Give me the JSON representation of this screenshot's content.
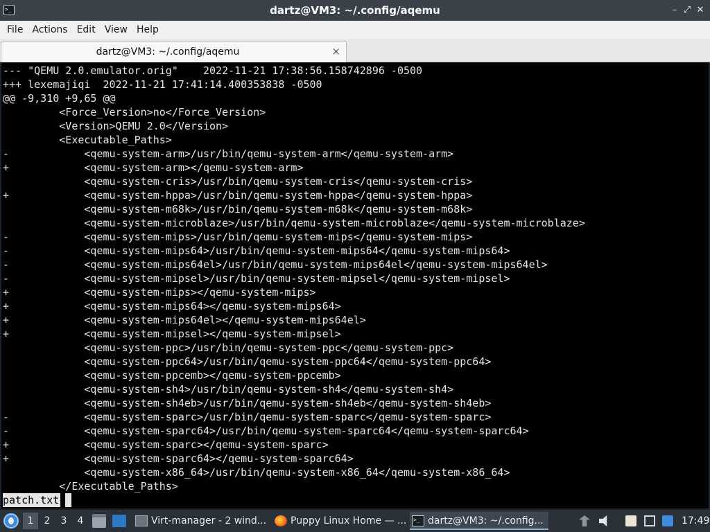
{
  "window": {
    "title": "dartz@VM3: ~/.config/aqemu",
    "app_icon_glyph": ">_",
    "controls": {
      "minimize": "–",
      "maximize": "⤢",
      "close": "✕"
    }
  },
  "menubar": {
    "items": [
      "File",
      "Actions",
      "Edit",
      "View",
      "Help"
    ]
  },
  "tabs": [
    {
      "label": "dartz@VM3: ~/.config/aqemu",
      "close": "×"
    }
  ],
  "terminal": {
    "lines": [
      "--- \"QEMU 2.0.emulator.orig\"    2022-11-21 17:38:56.158742896 -0500",
      "+++ lexemajiqi  2022-11-21 17:41:14.400353838 -0500",
      "@@ -9,310 +9,65 @@",
      "         <Force_Version>no</Force_Version>",
      "         <Version>QEMU 2.0</Version>",
      "         <Executable_Paths>",
      "-            <qemu-system-arm>/usr/bin/qemu-system-arm</qemu-system-arm>",
      "+            <qemu-system-arm></qemu-system-arm>",
      "             <qemu-system-cris>/usr/bin/qemu-system-cris</qemu-system-cris>",
      "+            <qemu-system-hppa>/usr/bin/qemu-system-hppa</qemu-system-hppa>",
      "             <qemu-system-m68k>/usr/bin/qemu-system-m68k</qemu-system-m68k>",
      "             <qemu-system-microblaze>/usr/bin/qemu-system-microblaze</qemu-system-microblaze>",
      "-            <qemu-system-mips>/usr/bin/qemu-system-mips</qemu-system-mips>",
      "-            <qemu-system-mips64>/usr/bin/qemu-system-mips64</qemu-system-mips64>",
      "-            <qemu-system-mips64el>/usr/bin/qemu-system-mips64el</qemu-system-mips64el>",
      "-            <qemu-system-mipsel>/usr/bin/qemu-system-mipsel</qemu-system-mipsel>",
      "+            <qemu-system-mips></qemu-system-mips>",
      "+            <qemu-system-mips64></qemu-system-mips64>",
      "+            <qemu-system-mips64el></qemu-system-mips64el>",
      "+            <qemu-system-mipsel></qemu-system-mipsel>",
      "             <qemu-system-ppc>/usr/bin/qemu-system-ppc</qemu-system-ppc>",
      "             <qemu-system-ppc64>/usr/bin/qemu-system-ppc64</qemu-system-ppc64>",
      "             <qemu-system-ppcemb></qemu-system-ppcemb>",
      "             <qemu-system-sh4>/usr/bin/qemu-system-sh4</qemu-system-sh4>",
      "             <qemu-system-sh4eb>/usr/bin/qemu-system-sh4eb</qemu-system-sh4eb>",
      "-            <qemu-system-sparc>/usr/bin/qemu-system-sparc</qemu-system-sparc>",
      "-            <qemu-system-sparc64>/usr/bin/qemu-system-sparc64</qemu-system-sparc64>",
      "+            <qemu-system-sparc></qemu-system-sparc>",
      "+            <qemu-system-sparc64></qemu-system-sparc64>",
      "             <qemu-system-x86_64>/usr/bin/qemu-system-x86_64</qemu-system-x86_64>",
      "         </Executable_Paths>"
    ],
    "status_line": "patch.txt"
  },
  "taskbar": {
    "workspaces": [
      "1",
      "2",
      "3",
      "4"
    ],
    "active_workspace": "1",
    "tasks": [
      {
        "label": "Virt-manager - 2 wind...",
        "icon": "virt-manager-icon"
      },
      {
        "label": "Puppy Linux Home — ...",
        "icon": "firefox-icon"
      },
      {
        "label": "dartz@VM3: ~/.config...",
        "icon": "terminal-icon",
        "active": true
      }
    ],
    "clock": "17:49"
  },
  "colors": {
    "titlebar": "#3a4148",
    "terminal_bg": "#000000",
    "terminal_fg": "#e4e4e4",
    "taskbar": "#2b3139"
  }
}
